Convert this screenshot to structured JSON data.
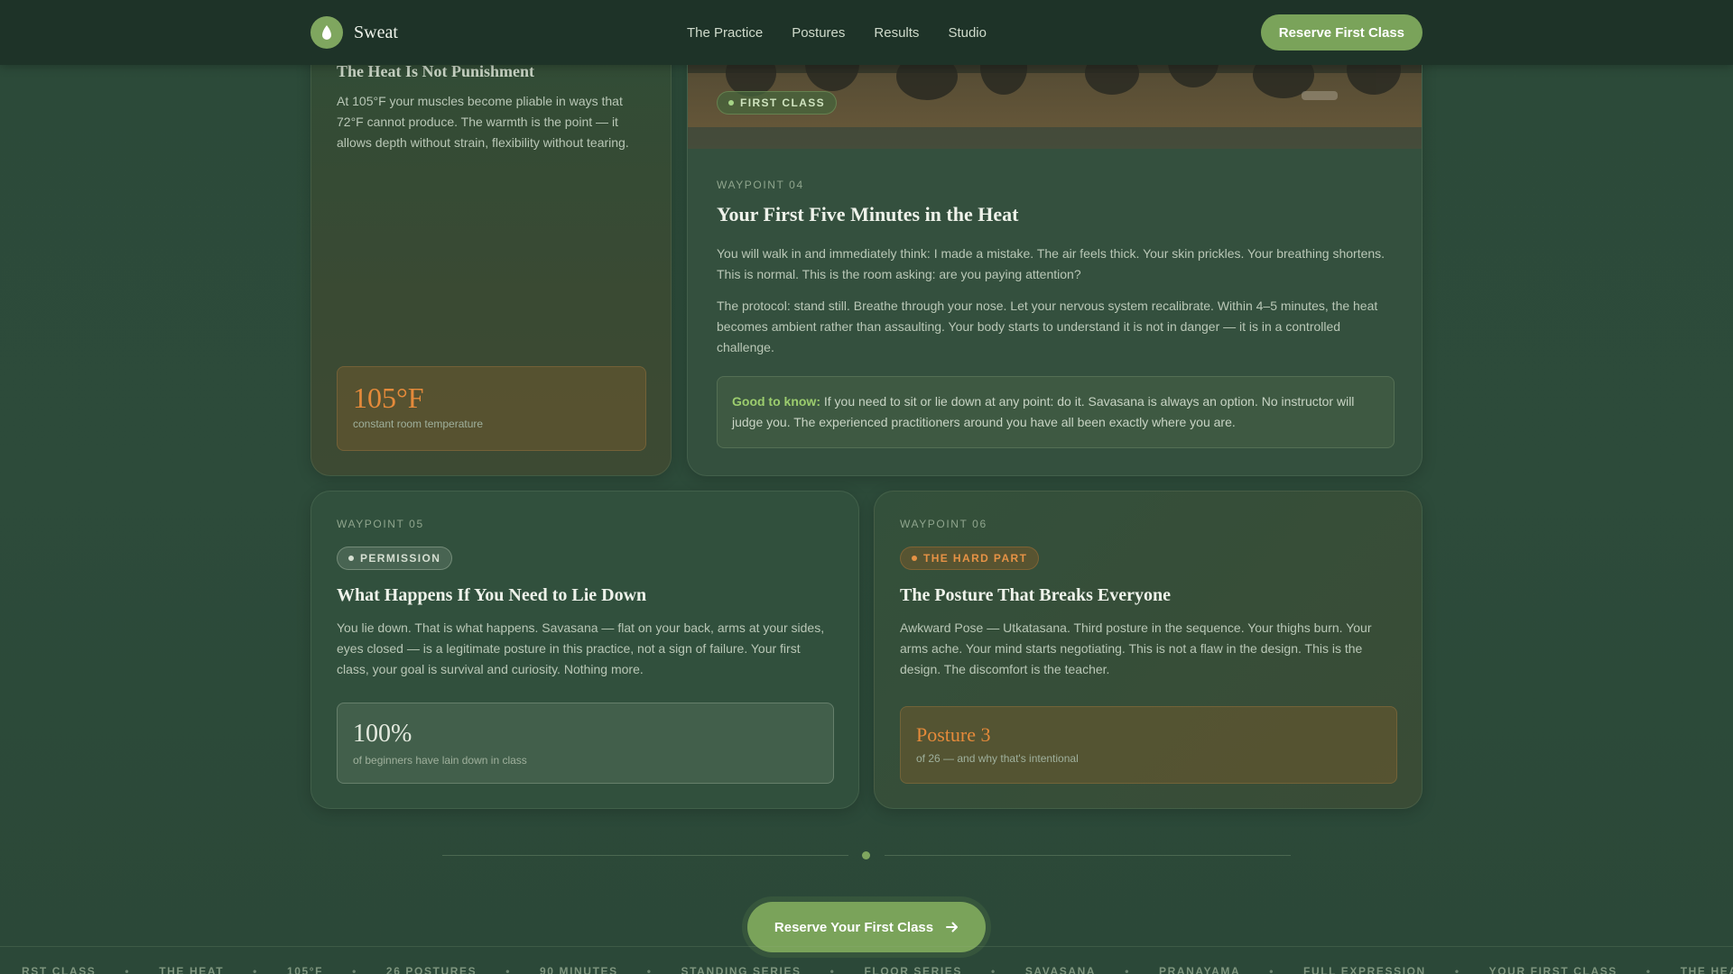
{
  "nav": {
    "brand": "Sweat",
    "links": [
      "The Practice",
      "Postures",
      "Results",
      "Studio"
    ],
    "cta": "Reserve First Class"
  },
  "card_a": {
    "title": "The Heat Is Not Punishment",
    "text": "At 105°F your muscles become pliable in ways that 72°F cannot produce. The warmth is the point — it allows depth without strain, flexibility without tearing.",
    "stat_value": "105°F",
    "stat_label": "constant room temperature"
  },
  "card_b": {
    "pill": "FIRST CLASS",
    "waypoint": "WAYPOINT 04",
    "title": "Your First Five Minutes in the Heat",
    "p1": "You will walk in and immediately think: I made a mistake. The air feels thick. Your skin prickles. Your breathing shortens. This is normal. This is the room asking: are you paying attention?",
    "p2": "The protocol: stand still. Breathe through your nose. Let your nervous system recalibrate. Within 4–5 minutes, the heat becomes ambient rather than assaulting. Your body starts to understand it is not in danger — it is in a controlled challenge.",
    "note_label": "Good to know:",
    "note_text": " If you need to sit or lie down at any point: do it. Savasana is always an option. No instructor will judge you. The experienced practitioners around you have all been exactly where you are."
  },
  "card_c": {
    "waypoint": "WAYPOINT 05",
    "pill": "PERMISSION",
    "title": "What Happens If You Need to Lie Down",
    "text": "You lie down. That is what happens. Savasana — flat on your back, arms at your sides, eyes closed — is a legitimate posture in this practice, not a sign of failure. Your first class, your goal is survival and curiosity. Nothing more.",
    "stat_value": "100%",
    "stat_label": "of beginners have lain down in class"
  },
  "card_d": {
    "waypoint": "WAYPOINT 06",
    "pill": "THE HARD PART",
    "title": "The Posture That Breaks Everyone",
    "text": "Awkward Pose — Utkatasana. Third posture in the sequence. Your thighs burn. Your arms ache. Your mind starts negotiating. This is not a flaw in the design. This is the design. The discomfort is the teacher.",
    "stat_value": "Posture 3",
    "stat_label": "of 26 — and why that's intentional"
  },
  "cta": {
    "label": "Reserve Your First Class"
  },
  "marquee": [
    "RST CLASS",
    "THE HEAT",
    "105°F",
    "26 POSTURES",
    "90 MINUTES",
    "STANDING SERIES",
    "FLOOR SERIES",
    "SAVASANA",
    "PRANAYAMA",
    "FULL EXPRESSION",
    "YOUR FIRST CLASS",
    "THE HEAT"
  ],
  "colors": {
    "accent": "#7aa35a",
    "orange": "#e58a3a",
    "bg": "#2c4a39",
    "nav": "#1e3328"
  },
  "icons": {
    "logo": "leaf-drop-icon",
    "cta": "arrow-right-icon"
  }
}
